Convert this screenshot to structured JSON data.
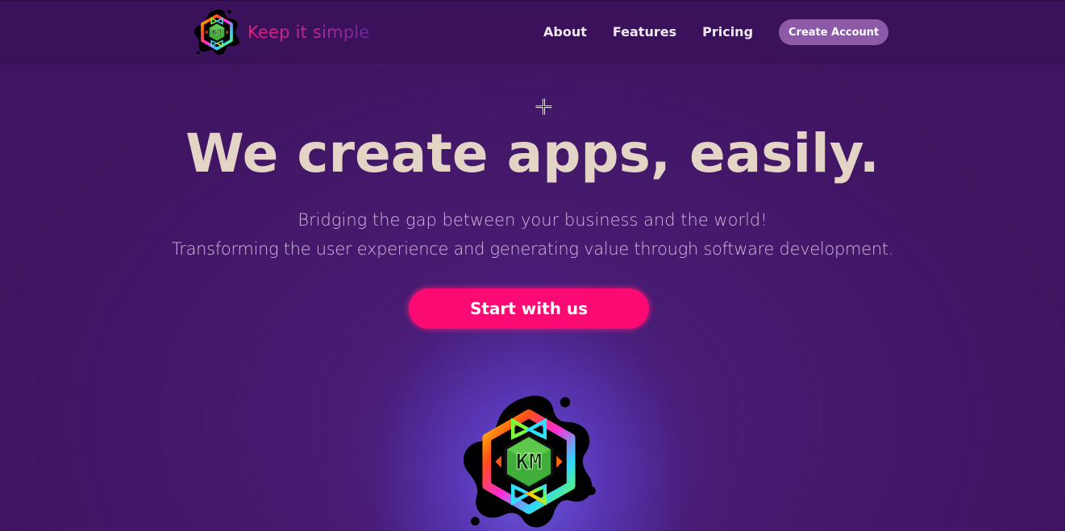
{
  "brand": {
    "name": "Keep it simple",
    "monogram": "KM",
    "logo_icon": "km-flower-logo-icon"
  },
  "nav": {
    "links": [
      "About",
      "Features",
      "Pricing"
    ],
    "cta_label": "Create Account"
  },
  "hero": {
    "title": "We create apps, easily.",
    "subtitle_line1": "Bridging the gap between your business and the world!",
    "subtitle_line2": "Transforming the user experience and generating value through software development.",
    "cta_label": "Start with us",
    "logo_icon": "km-flower-logo-icon"
  },
  "cursor": {
    "icon": "crosshair-cursor-icon"
  },
  "colors": {
    "background": "#3f1460",
    "glow": "#6e5ce6",
    "title": "#e3d4c6",
    "subtitle": "#cfb7dc",
    "nav_link": "#f1e9f4",
    "nav_cta_bg": "#8c5aa9",
    "cta_bg": "#fb0a73",
    "brand_gradient_start": "#e0217e",
    "brand_gradient_end": "#6b2a9a",
    "logo_green": "#3fae3a"
  }
}
